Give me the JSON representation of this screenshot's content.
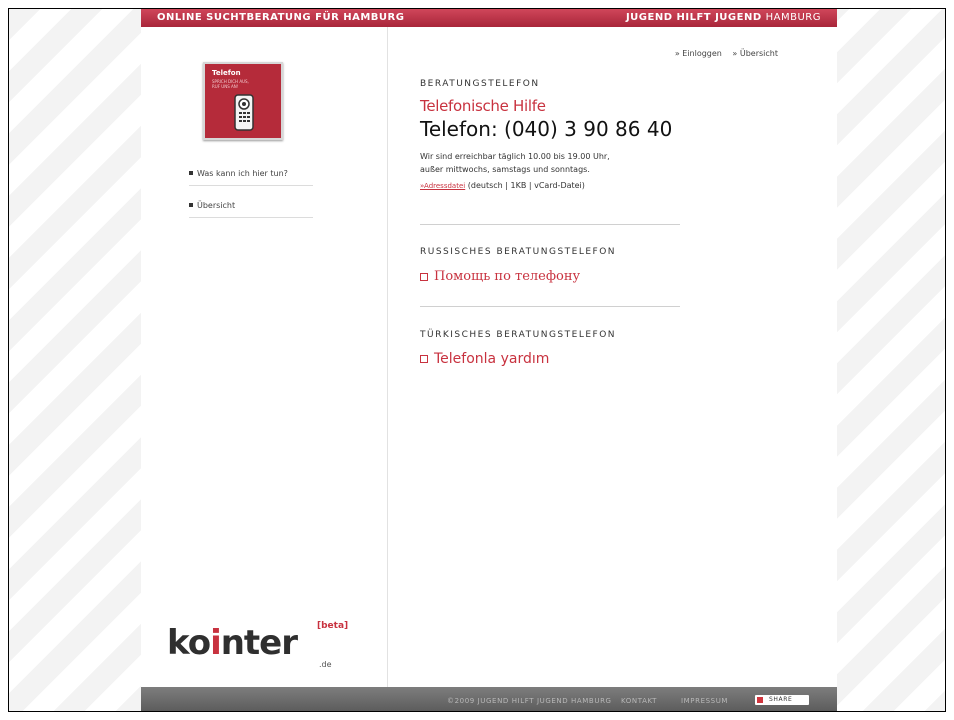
{
  "header": {
    "left_title": "ONLINE SUCHTBERATUNG FÜR HAMBURG",
    "right_bold": "JUGEND HILFT JUGEND",
    "right_light": "HAMBURG"
  },
  "sidebar": {
    "card_title": "Telefon",
    "card_subtitle": "SPRICH DICH AUS, RUF UNS AN!",
    "items": [
      {
        "label": "Was kann ich hier tun?"
      },
      {
        "label": "Übersicht"
      }
    ],
    "logo": {
      "word_a": "ko",
      "word_b": "i",
      "word_c": "nter",
      "beta": "[beta]",
      "tld": ".de"
    }
  },
  "top_links": {
    "login": "» Einloggen",
    "overview": "» Übersicht"
  },
  "main": {
    "section1_head": "BERATUNGSTELEFON",
    "section1_link": "Telefonische Hilfe",
    "phone": "Telefon: (040) 3 90 86 40",
    "info_line1": "Wir sind erreichbar täglich 10.00 bis 19.00 Uhr,",
    "info_line2": "außer mittwochs, samstags und sonntags.",
    "adress_link": "»Adressdatei",
    "adress_meta": "(deutsch | 1KB | vCard-Datei)",
    "section2_head": "RUSSISCHES BERATUNGSTELEFON",
    "section2_link": "Помощь по телефону",
    "section3_head": "TÜRKISCHES BERATUNGSTELEFON",
    "section3_link": "Telefonla yardım"
  },
  "footer": {
    "copyright": "©2009 JUGEND HILFT JUGEND HAMBURG",
    "contact": "KONTAKT",
    "impressum": "IMPRESSUM",
    "share": "SHARE"
  },
  "colors": {
    "accent": "#c8323f",
    "header_red": "#b52b3a",
    "footer_gray": "#6b6b6b"
  }
}
